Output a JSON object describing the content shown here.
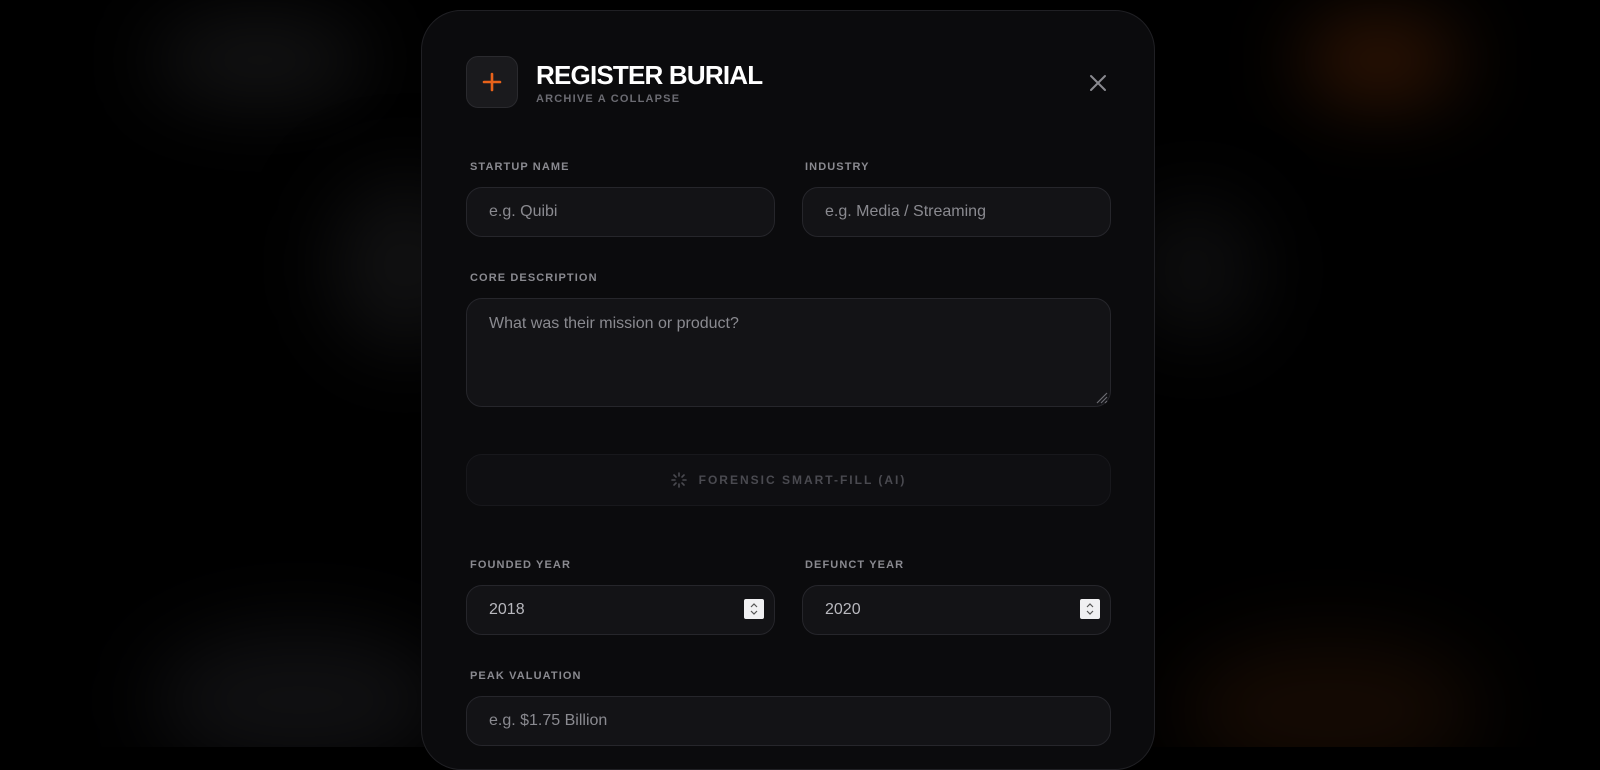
{
  "modal": {
    "title": "REGISTER BURIAL",
    "subtitle": "ARCHIVE A COLLAPSE",
    "header_icon": "plus-icon",
    "close_icon": "close-icon",
    "accent_color": "#e8621a"
  },
  "form": {
    "startup_name": {
      "label": "STARTUP NAME",
      "placeholder": "e.g. Quibi",
      "value": ""
    },
    "industry": {
      "label": "INDUSTRY",
      "placeholder": "e.g. Media / Streaming",
      "value": ""
    },
    "description": {
      "label": "CORE DESCRIPTION",
      "placeholder": "What was their mission or product?",
      "value": ""
    },
    "smartfill": {
      "label": "FORENSIC SMART-FILL (AI)",
      "icon": "spinner-icon"
    },
    "founded_year": {
      "label": "FOUNDED YEAR",
      "value": "2018"
    },
    "defunct_year": {
      "label": "DEFUNCT YEAR",
      "value": "2020"
    },
    "peak_valuation": {
      "label": "PEAK VALUATION",
      "placeholder": "e.g. $1.75 Billion",
      "value": ""
    }
  }
}
